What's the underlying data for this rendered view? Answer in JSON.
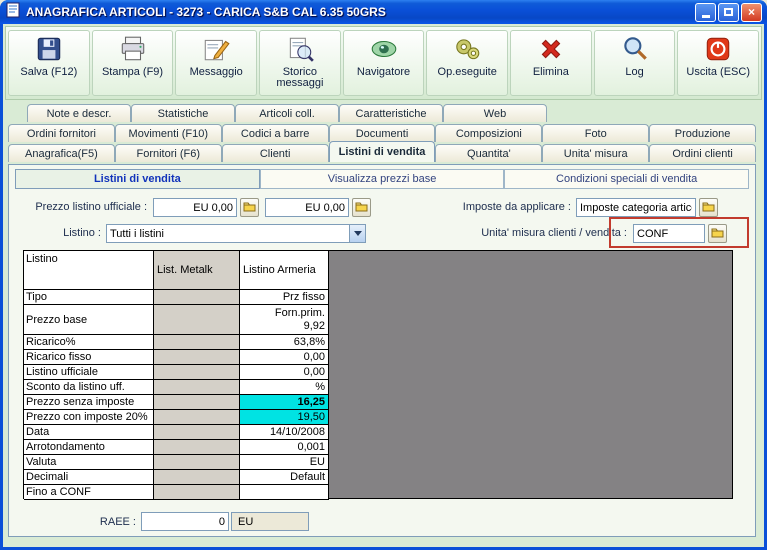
{
  "window": {
    "title": "ANAGRAFICA ARTICOLI - 3273 - CARICA S&B CAL 6.35 50GRS"
  },
  "colors": {
    "titlebar_blue": "#0A50D8",
    "toolbar_green": "#D4E9D0",
    "highlight_cyan": "#00E3E3",
    "annotation_red": "#C23B2E",
    "grid_empty_gray": "#848284"
  },
  "toolbar": {
    "buttons": [
      {
        "label": "Salva (F12)",
        "icon": "save-icon"
      },
      {
        "label": "Stampa (F9)",
        "icon": "printer-icon"
      },
      {
        "label": "Messaggio",
        "icon": "message-icon"
      },
      {
        "label": "Storico messaggi",
        "icon": "message-history-icon"
      },
      {
        "label": "Navigatore",
        "icon": "navigator-icon"
      },
      {
        "label": "Op.eseguite",
        "icon": "gears-icon"
      },
      {
        "label": "Elimina",
        "icon": "delete-icon"
      },
      {
        "label": "Log",
        "icon": "log-icon"
      },
      {
        "label": "Uscita (ESC)",
        "icon": "exit-icon"
      }
    ]
  },
  "tab_rows": {
    "row1": [
      {
        "label": "Note e descr."
      },
      {
        "label": "Statistiche"
      },
      {
        "label": "Articoli coll."
      },
      {
        "label": "Caratteristiche"
      },
      {
        "label": "Web"
      }
    ],
    "row2": [
      {
        "label": "Ordini fornitori"
      },
      {
        "label": "Movimenti (F10)"
      },
      {
        "label": "Codici a barre"
      },
      {
        "label": "Documenti"
      },
      {
        "label": "Composizioni"
      },
      {
        "label": "Foto"
      },
      {
        "label": "Produzione"
      }
    ],
    "row3": [
      {
        "label": "Anagrafica(F5)"
      },
      {
        "label": "Fornitori (F6)"
      },
      {
        "label": "Clienti"
      },
      {
        "label": "Listini di vendita",
        "active": true
      },
      {
        "label": "Quantita'"
      },
      {
        "label": "Unita' misura"
      },
      {
        "label": "Ordini clienti"
      }
    ]
  },
  "panel": {
    "tabs": [
      {
        "label": "Listini di vendita",
        "active": true
      },
      {
        "label": "Visualizza prezzi base"
      },
      {
        "label": "Condizioni speciali di vendita"
      }
    ],
    "fields": {
      "prezzo_listino_label": "Prezzo listino ufficiale :",
      "prezzo_value_1": "EU 0,00",
      "prezzo_value_2": "EU 0,00",
      "imposte_label": "Imposte da applicare :",
      "imposte_value": "Imposte categoria articolo",
      "listino_label": "Listino :",
      "listino_value": "Tutti i listini",
      "unita_label": "Unita' misura clienti / vendita :",
      "unita_value": "CONF"
    },
    "raee": {
      "label": "RAEE :",
      "value": "0",
      "currency": "EU"
    }
  },
  "table": {
    "columns": [
      "Listino",
      "List. Metalk",
      "Listino  Armeria"
    ],
    "rows": [
      {
        "label": "Tipo",
        "value": "Prz fisso"
      },
      {
        "label": "Prezzo base",
        "value": "Forn.prim.\n9,92",
        "tall": true
      },
      {
        "label": "Ricarico%",
        "value": "63,8%"
      },
      {
        "label": "Ricarico fisso",
        "value": "0,00"
      },
      {
        "label": "Listino ufficiale",
        "value": "0,00"
      },
      {
        "label": "Sconto da listino uff.",
        "value": "%"
      },
      {
        "label": "Prezzo senza imposte",
        "value": "16,25",
        "highlight": "cyan",
        "bold": true
      },
      {
        "label": "Prezzo con imposte 20%",
        "value": "19,50",
        "highlight": "cyan"
      },
      {
        "label": "Data",
        "value": "14/10/2008"
      },
      {
        "label": "Arrotondamento",
        "value": "0,001"
      },
      {
        "label": "Valuta",
        "value": "EU"
      },
      {
        "label": "Decimali",
        "value": "Default"
      },
      {
        "label": "Fino a CONF",
        "value": ""
      }
    ]
  }
}
